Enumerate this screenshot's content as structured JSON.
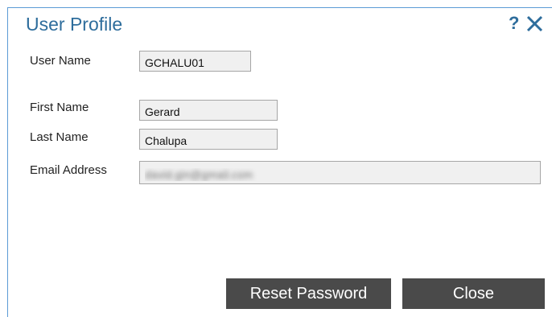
{
  "dialog": {
    "title": "User Profile",
    "help_label": "?",
    "close_icon": "close-x-icon"
  },
  "fields": {
    "user_name": {
      "label": "User Name",
      "value": "GCHALU01"
    },
    "first_name": {
      "label": "First Name",
      "value": "Gerard"
    },
    "last_name": {
      "label": "Last Name",
      "value": "Chalupa"
    },
    "email": {
      "label": "Email Address",
      "value": "david.gin@gmail.com"
    }
  },
  "buttons": {
    "reset_password": "Reset Password",
    "close": "Close"
  },
  "colors": {
    "title": "#2e6d9c",
    "button_bg": "#4a4a4a",
    "field_bg": "#f0f0f0",
    "dialog_border": "#5b9bd5"
  }
}
